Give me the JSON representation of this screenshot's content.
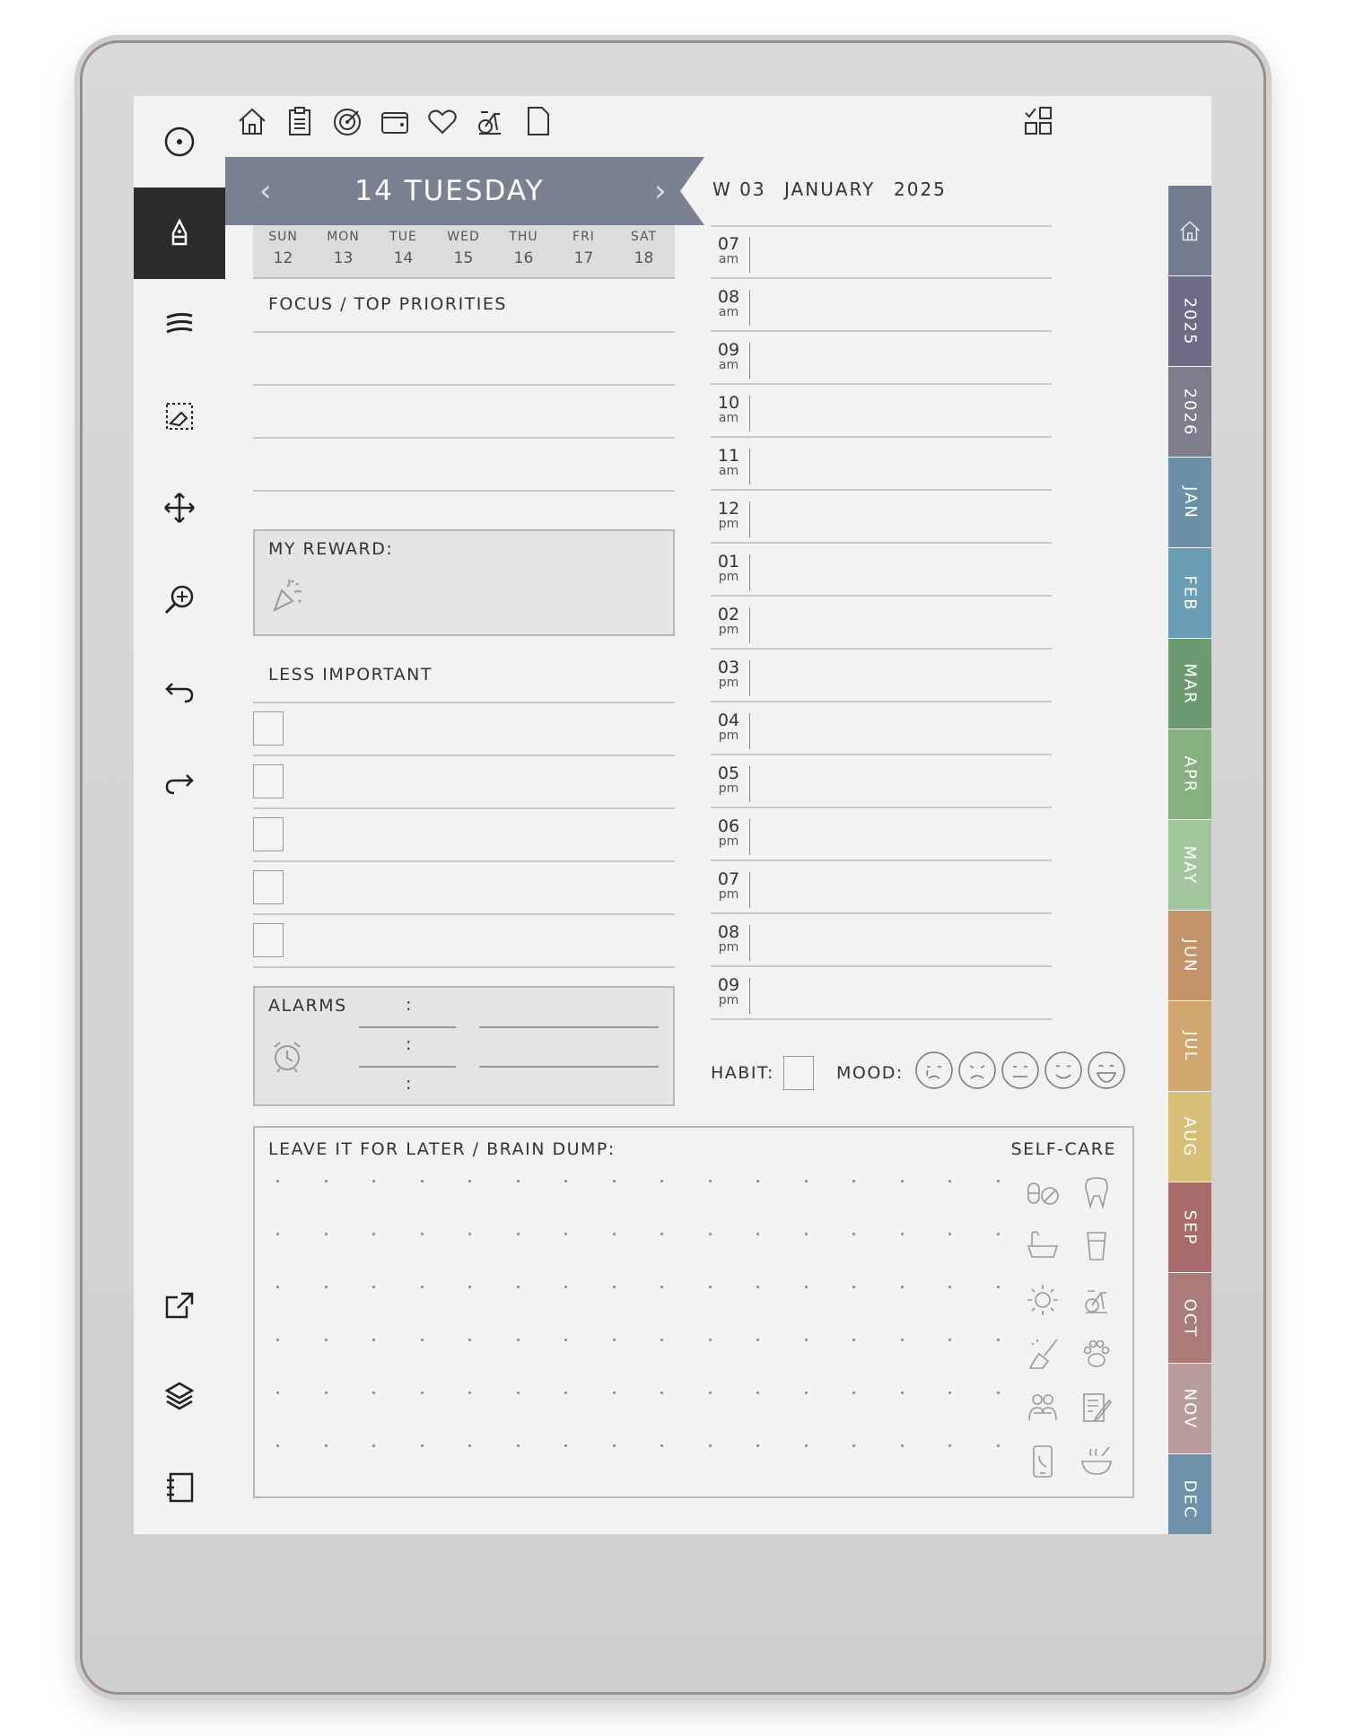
{
  "toolbar": {
    "icons": [
      "home-icon",
      "clipboard-icon",
      "target-icon",
      "wallet-icon",
      "heart-icon",
      "exercise-bike-icon",
      "page-icon"
    ],
    "right_icon": "layout-icon"
  },
  "sidebar": {
    "icons": [
      "menu-circle-icon",
      "pen-tool-icon",
      "stroke-icon",
      "eraser-select-icon",
      "move-icon",
      "zoom-icon",
      "undo-icon",
      "redo-icon",
      "export-icon",
      "layers-icon",
      "notebook-icon"
    ]
  },
  "day": {
    "title": "14 TUESDAY",
    "prev": "‹",
    "next": "›",
    "week": "W 03",
    "month": "JANUARY",
    "year": "2025",
    "banner_color": "#7a8191"
  },
  "week_strip": [
    {
      "name": "SUN",
      "date": "12"
    },
    {
      "name": "MON",
      "date": "13"
    },
    {
      "name": "TUE",
      "date": "14"
    },
    {
      "name": "WED",
      "date": "15"
    },
    {
      "name": "THU",
      "date": "16"
    },
    {
      "name": "FRI",
      "date": "17"
    },
    {
      "name": "SAT",
      "date": "18"
    }
  ],
  "sections": {
    "focus": "FOCUS / TOP PRIORITIES",
    "reward": "MY REWARD:",
    "less_important": "LESS IMPORTANT",
    "alarms": "ALARMS",
    "alarm_colon": ":",
    "habit": "HABIT:",
    "mood": "MOOD:",
    "brain_dump": "LEAVE IT FOR LATER / BRAIN DUMP:",
    "self_care": "SELF-CARE"
  },
  "hours": [
    {
      "h": "07",
      "ap": "am"
    },
    {
      "h": "08",
      "ap": "am"
    },
    {
      "h": "09",
      "ap": "am"
    },
    {
      "h": "10",
      "ap": "am"
    },
    {
      "h": "11",
      "ap": "am"
    },
    {
      "h": "12",
      "ap": "pm"
    },
    {
      "h": "01",
      "ap": "pm"
    },
    {
      "h": "02",
      "ap": "pm"
    },
    {
      "h": "03",
      "ap": "pm"
    },
    {
      "h": "04",
      "ap": "pm"
    },
    {
      "h": "05",
      "ap": "pm"
    },
    {
      "h": "06",
      "ap": "pm"
    },
    {
      "h": "07",
      "ap": "pm"
    },
    {
      "h": "08",
      "ap": "pm"
    },
    {
      "h": "09",
      "ap": "pm"
    }
  ],
  "tabs": [
    {
      "label": "",
      "color": "#737c8e",
      "icon": "home-icon"
    },
    {
      "label": "2025",
      "color": "#6f6a86"
    },
    {
      "label": "2026",
      "color": "#7f7c8c"
    },
    {
      "label": "JAN",
      "color": "#6a91a8"
    },
    {
      "label": "FEB",
      "color": "#6b9db5"
    },
    {
      "label": "MAR",
      "color": "#6e9a72"
    },
    {
      "label": "APR",
      "color": "#86b07f"
    },
    {
      "label": "MAY",
      "color": "#a3c59d"
    },
    {
      "label": "JUN",
      "color": "#c3936a"
    },
    {
      "label": "JUL",
      "color": "#d1a56f"
    },
    {
      "label": "AUG",
      "color": "#d8bf78"
    },
    {
      "label": "SEP",
      "color": "#a86a6a"
    },
    {
      "label": "OCT",
      "color": "#ab7b79"
    },
    {
      "label": "NOV",
      "color": "#b89c9b"
    },
    {
      "label": "DEC",
      "color": "#6f92aa"
    }
  ],
  "self_care_icons": [
    "pills-icon",
    "tooth-icon",
    "bathtub-icon",
    "glass-icon",
    "sun-icon",
    "exercise-bike-icon",
    "cleaning-icon",
    "paw-icon",
    "hug-icon",
    "journal-icon",
    "phone-icon",
    "bowl-icon"
  ],
  "moods": [
    "crying-face-icon",
    "sad-face-icon",
    "neutral-face-icon",
    "smile-face-icon",
    "happy-face-icon"
  ]
}
